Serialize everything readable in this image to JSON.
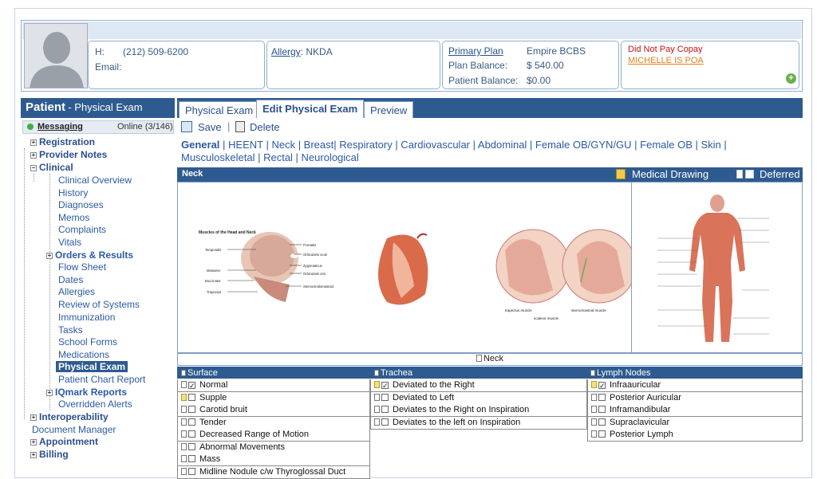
{
  "patient": {
    "phone_label": "H:",
    "phone": "(212) 509-6200",
    "email_label": "Email:",
    "allergy_label": "Allergy",
    "allergy_value": ": NKDA",
    "primary_plan_label": "Primary Plan",
    "primary_plan": "Empire BCBS",
    "plan_balance_label": "Plan Balance:",
    "plan_balance": "$ 540.00",
    "patient_balance_label": "Patient Balance:",
    "patient_balance": "$0.00",
    "alert1": "Did Not Pay Copay",
    "alert2": "MICHELLE IS POA"
  },
  "left": {
    "title": "Patient",
    "subtitle": "- Physical Exam",
    "messaging": "Messaging",
    "online": "Online (3/146)",
    "tree": {
      "registration": "Registration",
      "provider_notes": "Provider Notes",
      "clinical": "Clinical",
      "clinical_overview": "Clinical Overview",
      "history": "History",
      "diagnoses": "Diagnoses",
      "memos": "Memos",
      "complaints": "Complaints",
      "vitals": "Vitals",
      "orders": "Orders & Results",
      "flow_sheet": "Flow Sheet",
      "dates": "Dates",
      "allergies": "Allergies",
      "review": "Review of Systems",
      "immunization": "Immunization",
      "tasks": "Tasks",
      "school_forms": "School Forms",
      "medications": "Medications",
      "physical_exam": "Physical Exam",
      "chart_report": "Patient Chart Report",
      "iqmark": "IQmark Reports",
      "overridden": "Overridden Alerts",
      "interop": "Interoperability",
      "doc_manager": "Document Manager",
      "appointment": "Appointment",
      "billing": "Billing"
    }
  },
  "tabs": [
    "Physical Exam",
    "Edit Physical Exam",
    "Preview"
  ],
  "toolbar": {
    "save": "Save",
    "delete": "Delete"
  },
  "nav": {
    "general": "General",
    "rest1": "| HEENT | Neck | Breast| Respiratory | Cardiovascular | Abdominal | Female OB/GYN/GU | Female OB | Skin |",
    "rest2": "Musculoskeletal | Rectal | Neurological"
  },
  "section": {
    "title": "Neck",
    "drawing": "Medical Drawing",
    "deferred": "Deferred",
    "caption": "Neck"
  },
  "diagram": {
    "title": "Muscles of the Head and Neck",
    "l1": "Temporalis",
    "l2": "Masseter",
    "l3": "Buccinator",
    "l4": "Trapezius",
    "r1": "Frontalis",
    "r2": "Orbicularis oculi",
    "r3": "Zygomaticus",
    "r4": "Orbicularis oris",
    "r5": "Sternocleidomastoid",
    "c1": "trapezius muscle",
    "c2": "sternomastoid muscle",
    "c3": "scalene muscle"
  },
  "grid": {
    "surface_head": "Surface",
    "trachea_head": "Trachea",
    "lymph_head": "Lymph Nodes",
    "surface": [
      "Normal",
      "Supple",
      "Carotid bruit",
      "Tender",
      "Decreased Range of Motion",
      "Abnormal Movements",
      "Mass",
      "Midline Nodule c/w Thyroglossal Duct"
    ],
    "trachea": [
      "Deviated to the Right",
      "Deviated to Left",
      "Deviates to the Right on Inspiration",
      "Deviates to the left on Inspiration"
    ],
    "lymph": [
      "Infraauricular",
      "Posterior Auricular",
      "Inframandibular",
      "Supraclavicular",
      "Posterior Lymph"
    ]
  }
}
